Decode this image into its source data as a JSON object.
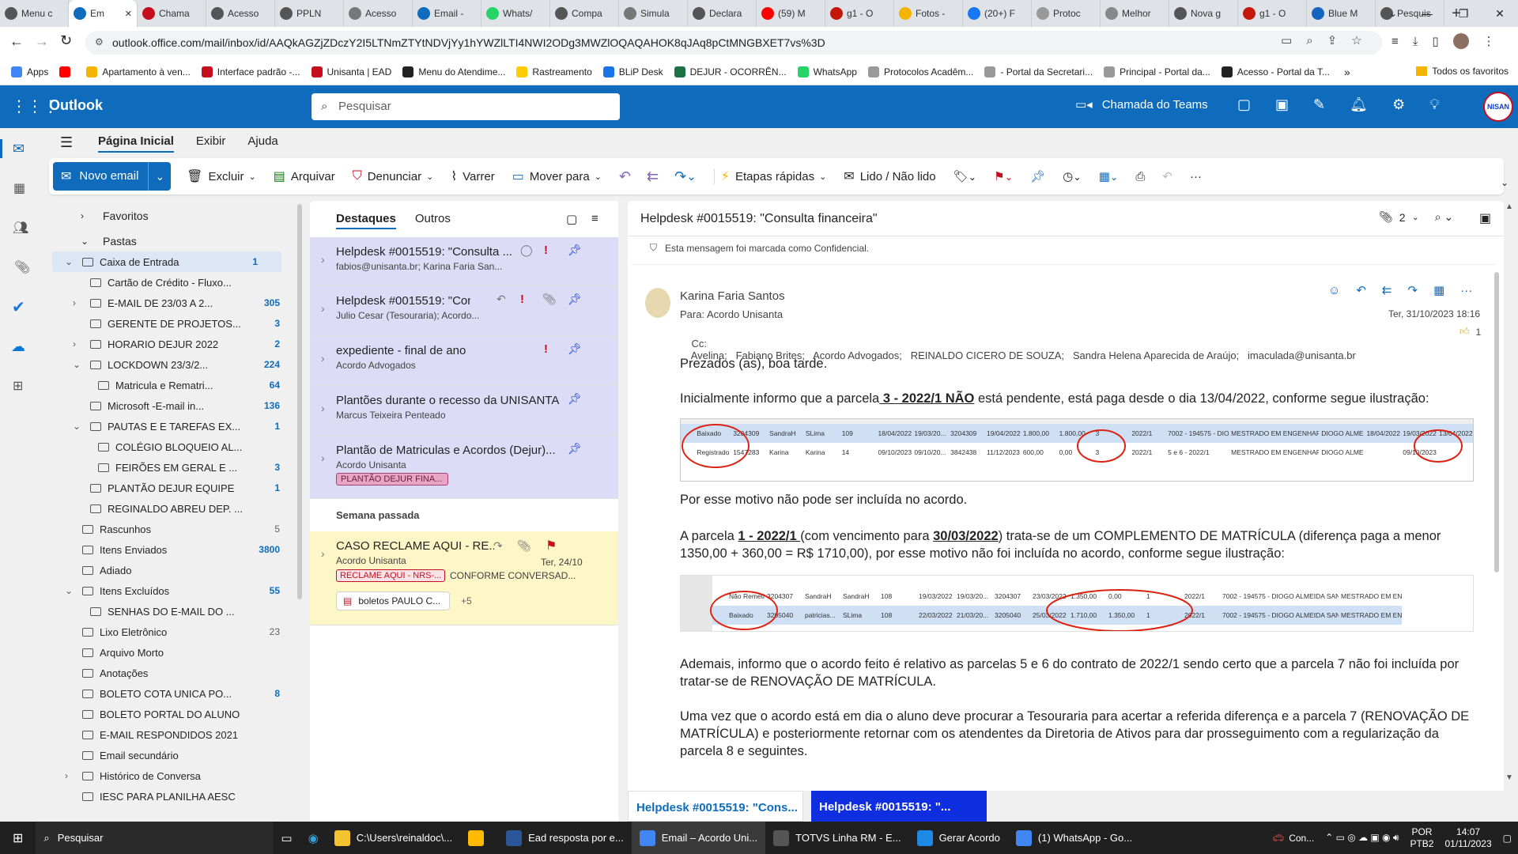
{
  "browser": {
    "tabs": [
      {
        "label": "Menu c",
        "color": "#555"
      },
      {
        "label": "Em",
        "color": "#0f6cbd",
        "active": true
      },
      {
        "label": "Chama",
        "color": "#c50f1f"
      },
      {
        "label": "Acesso",
        "color": "#555"
      },
      {
        "label": "PPLN",
        "color": "#555"
      },
      {
        "label": "Acesso",
        "color": "#777"
      },
      {
        "label": "Email -",
        "color": "#0f6cbd"
      },
      {
        "label": "Whats/",
        "color": "#25d366"
      },
      {
        "label": "Compa",
        "color": "#555"
      },
      {
        "label": "Simula",
        "color": "#777"
      },
      {
        "label": "Declara",
        "color": "#555"
      },
      {
        "label": "(59) M",
        "color": "#ff0000"
      },
      {
        "label": "g1 - O",
        "color": "#c4170c"
      },
      {
        "label": "Fotos -",
        "color": "#f4b400"
      },
      {
        "label": "(20+) F",
        "color": "#1877f2"
      },
      {
        "label": "Protoc",
        "color": "#999"
      },
      {
        "label": "Melhor",
        "color": "#888"
      },
      {
        "label": "Nova g",
        "color": "#555"
      },
      {
        "label": "g1 - O",
        "color": "#c4170c"
      },
      {
        "label": "Blue M",
        "color": "#1565c0"
      },
      {
        "label": "Pesquis",
        "color": "#555"
      }
    ],
    "url": "outlook.office.com/mail/inbox/id/AAQkAGZjZDczY2I5LTNmZTYtNDVjYy1hYWZlLTI4NWI2ODg3MWZlOQAQAHOK8qJAq8pCtMNGBXET7vs%3D",
    "bookmarks": [
      {
        "label": "Apps",
        "color": "#4285f4"
      },
      {
        "label": "",
        "color": "#ff0000"
      },
      {
        "label": "Apartamento à ven...",
        "color": "#f4b400"
      },
      {
        "label": "Interface padrão -...",
        "color": "#c50f1f"
      },
      {
        "label": "Unisanta | EAD",
        "color": "#c50f1f"
      },
      {
        "label": "Menu do Atendime...",
        "color": "#222"
      },
      {
        "label": "Rastreamento",
        "color": "#ffcc00"
      },
      {
        "label": "BLiP Desk",
        "color": "#1a73e8"
      },
      {
        "label": "DEJUR - OCORRÊN...",
        "color": "#1e7145"
      },
      {
        "label": "WhatsApp",
        "color": "#25d366"
      },
      {
        "label": "Protocolos Acadêm...",
        "color": "#999"
      },
      {
        "label": "- Portal da Secretari...",
        "color": "#999"
      },
      {
        "label": "Principal - Portal da...",
        "color": "#999"
      },
      {
        "label": "Acesso - Portal da T...",
        "color": "#222"
      }
    ],
    "bookmarks_more": "»",
    "all_favorites": "Todos os favoritos"
  },
  "outlook": {
    "app_name": "Outlook",
    "search_placeholder": "Pesquisar",
    "teams_call": "Chamada do Teams",
    "avatar_text": "NISAN",
    "ribbon_tabs": [
      "Página Inicial",
      "Exibir",
      "Ajuda"
    ],
    "ribbon": {
      "new_mail": "Novo email",
      "delete": "Excluir",
      "archive": "Arquivar",
      "report": "Denunciar",
      "sweep": "Varrer",
      "move_to": "Mover para",
      "quick_steps": "Etapas rápidas",
      "read_unread": "Lido / Não lido",
      "more": "···"
    }
  },
  "folders": {
    "favorites": "Favoritos",
    "folders": "Pastas",
    "items": [
      {
        "label": "Caixa de Entrada",
        "count": "1",
        "indent": 1,
        "chev": "v",
        "selected": true,
        "bold_count": true
      },
      {
        "label": "Cartão de Crédito - Fluxo...",
        "count": "",
        "indent": 2,
        "chev": ""
      },
      {
        "label": "E-MAIL DE 23/03 A 2...",
        "count": "305",
        "indent": 2,
        "chev": ">",
        "bold_count": true
      },
      {
        "label": "GERENTE DE PROJETOS...",
        "count": "3",
        "indent": 2,
        "chev": "",
        "bold_count": true
      },
      {
        "label": "HORARIO DEJUR 2022",
        "count": "2",
        "indent": 2,
        "chev": ">",
        "bold_count": true
      },
      {
        "label": "LOCKDOWN 23/3/2...",
        "count": "224",
        "indent": 2,
        "chev": "v",
        "bold_count": true
      },
      {
        "label": "Matricula e Rematri...",
        "count": "64",
        "indent": 3,
        "chev": "",
        "bold_count": true
      },
      {
        "label": "Microsoft -E-mail in...",
        "count": "136",
        "indent": 2,
        "chev": "",
        "bold_count": true
      },
      {
        "label": "PAUTAS E E TAREFAS EX...",
        "count": "1",
        "indent": 2,
        "chev": "v",
        "bold_count": true
      },
      {
        "label": "COLÉGIO BLOQUEIO AL...",
        "count": "",
        "indent": 3,
        "chev": ""
      },
      {
        "label": "FEIRÕES EM GERAL E ...",
        "count": "3",
        "indent": 3,
        "chev": "",
        "bold_count": true
      },
      {
        "label": "PLANTÃO DEJUR EQUIPE",
        "count": "1",
        "indent": 2,
        "chev": "",
        "bold_count": true
      },
      {
        "label": "REGINALDO ABREU DEP. ...",
        "count": "",
        "indent": 2,
        "chev": ""
      },
      {
        "label": "Rascunhos",
        "count": "5",
        "indent": 1,
        "chev": ""
      },
      {
        "label": "Itens Enviados",
        "count": "3800",
        "indent": 1,
        "chev": "",
        "bold_count": true
      },
      {
        "label": "Adiado",
        "count": "",
        "indent": 1,
        "chev": ""
      },
      {
        "label": "Itens Excluídos",
        "count": "55",
        "indent": 1,
        "chev": "v",
        "bold_count": true
      },
      {
        "label": "SENHAS DO E-MAIL DO ...",
        "count": "",
        "indent": 2,
        "chev": ""
      },
      {
        "label": "Lixo Eletrônico",
        "count": "23",
        "indent": 1,
        "chev": ""
      },
      {
        "label": "Arquivo Morto",
        "count": "",
        "indent": 1,
        "chev": ""
      },
      {
        "label": "Anotações",
        "count": "",
        "indent": 1,
        "chev": ""
      },
      {
        "label": "BOLETO COTA UNICA PO...",
        "count": "8",
        "indent": 1,
        "chev": "",
        "bold_count": true
      },
      {
        "label": "BOLETO PORTAL DO ALUNO",
        "count": "",
        "indent": 1,
        "chev": ""
      },
      {
        "label": "E-MAIL RESPONDIDOS 2021",
        "count": "",
        "indent": 1,
        "chev": ""
      },
      {
        "label": "Email secundário",
        "count": "",
        "indent": 1,
        "chev": ""
      },
      {
        "label": "Histórico de Conversa",
        "count": "",
        "indent": 1,
        "chev": ">"
      },
      {
        "label": "IESC PARA PLANILHA AESC",
        "count": "",
        "indent": 1,
        "chev": ""
      }
    ]
  },
  "list": {
    "tab_focused": "Destaques",
    "tab_other": "Outros",
    "messages": [
      {
        "from": "Helpdesk #0015519: \"Consulta ...",
        "preview": "fabios@unisanta.br; Karina Faria San..."
      },
      {
        "from": "Helpdesk #0015519: \"Cons...",
        "preview": "Julio Cesar (Tesouraria); Acordo..."
      },
      {
        "from": "expediente - final de ano",
        "preview": "Acordo Advogados"
      },
      {
        "from": "Plantões durante o recesso da UNISANTA",
        "preview": "Marcus Teixeira Penteado"
      },
      {
        "from": "Plantão de Matriculas e Acordos (Dejur)...",
        "preview": "Acordo Unisanta",
        "tag": "PLANTÃO DEJUR FINA..."
      }
    ],
    "section_last_week": "Semana passada",
    "last_week": {
      "from": "CASO RECLAME AQUI - RE...",
      "preview": "Acordo Unisanta",
      "date": "Ter, 24/10",
      "tag": "RECLAME AQUI - NRS-...",
      "tag_preview": "CONFORME CONVERSAD...",
      "attachment": "boletos PAULO C...",
      "more_attachments": "+5"
    }
  },
  "reader": {
    "subject": "Helpdesk #0015519: \"Consulta financeira\"",
    "attachment_count": "2",
    "confidential": "Esta mensagem foi marcada como Confidencial.",
    "sender": "Karina Faria Santos",
    "to_label": "Para:",
    "to": "Acordo Unisanta",
    "cc_label": "Cc:",
    "cc": "Avelina;   Fabiano Brites;   Acordo Advogados;   REINALDO CICERO DE SOUZA;   Sandra Helena Aparecida de Araújo;   imaculada@unisanta.br",
    "date": "Ter, 31/10/2023 18:16",
    "likes": "1",
    "greeting": "Prezados (as), boa tarde.",
    "p1_a": "Inicialmente informo que a parcela",
    "p1_b": " 3 - 2022/1 NÃO",
    "p1_c": " está pendente, está paga desde o dia 13/04/2022, conforme segue ilustração:",
    "p2": "Por esse motivo não pode ser incluída no acordo.",
    "p3_a": "A parcela ",
    "p3_b": "1 - 2022/1 ",
    "p3_c": " (com vencimento para ",
    "p3_d": "30/03/2022",
    "p3_e": ") trata-se de um COMPLEMENTO DE MATRÍCULA (diferença paga a menor 1350,00 + 360,00 = R$ 1710,00), por esse motivo não foi incluída no acordo, conforme segue ilustração:",
    "p4": "Ademais, informo que o acordo feito é relativo as parcelas 5 e 6 do contrato de  2022/1 sendo certo que a parcela 7 não foi incluída por tratar-se de RENOVAÇÃO DE MATRÍCULA.",
    "p5": "Uma vez que o acordo está em dia o aluno deve procurar a Tesouraria para acertar a referida diferença e a parcela 7 (RENOVAÇÃO DE MATRÍCULA) e posteriormente retornar com os atendentes da Diretoria de Ativos para dar prosseguimento com a regularização da parcela 8 e seguintes.",
    "img1_rows": [
      [
        "",
        "Baixado",
        "3204309",
        "SandraH",
        "SLima",
        "109",
        "18/04/2022",
        "19/03/20...",
        "3204309",
        "19/04/2022",
        "1.800,00",
        "1.800,00",
        "3",
        "2022/1",
        "7002 - 194575 - DIOGO ...",
        "MESTRADO EM ENGENHARIA MECÂN...",
        "DIOGO ALMEIDA ...",
        "18/04/2022",
        "19/03/2022",
        "13/04/2022"
      ],
      [
        "",
        "Registrado",
        "1547283",
        "Karina",
        "Karina",
        "14",
        "09/10/2023",
        "09/10/20...",
        "3842438",
        "11/12/2023",
        "600,00",
        "0,00",
        "3",
        "2022/1",
        "5 e 6 - 2022/1",
        "MESTRADO EM ENGENHARIA MECÂN...",
        "DIOGO ALMEIDA ...",
        "",
        "09/10/2023",
        ""
      ]
    ],
    "img2_rows": [
      [
        "",
        "Não Remeti...",
        "3204307",
        "SandraH",
        "SandraH",
        "108",
        "19/03/2022",
        "19/03/20...",
        "3204307",
        "23/03/2022",
        "1.350,00",
        "0,00",
        "1",
        "2022/1",
        "7002 - 194575 - DIOGO ALMEIDA SANTOS",
        "MESTRADO EM ENG"
      ],
      [
        "",
        "Baixado",
        "3205040",
        "patricias...",
        "SLima",
        "108",
        "22/03/2022",
        "21/03/20...",
        "3205040",
        "25/03/2022",
        "1.710,00",
        "1.350,00",
        "1",
        "2022/1",
        "7002 - 194575 - DIOGO ALMEIDA SANTOS",
        "MESTRADO EM ENG"
      ],
      [
        "",
        "Cancelado",
        "3223050",
        "patricias...",
        "patriciasil...",
        "109",
        "24/03/2022",
        "24/03/20...",
        "3223050",
        "30/03/2022",
        "360,00",
        "0,00",
        "1",
        "2022/1",
        "7002 - 194575 - DIOGO ALMEIDA SANTOS",
        "MESTRADO EM ENG"
      ]
    ]
  },
  "bottom_tabs": [
    "Helpdesk #0015519: \"Cons...",
    "Helpdesk #0015519: \"..."
  ],
  "taskbar": {
    "search": "Pesquisar",
    "apps": [
      {
        "label": "C:\\Users\\reinaldoc\\...",
        "color": "#f4c430"
      },
      {
        "label": "",
        "color": "#ffb900"
      },
      {
        "label": "Ead resposta por e...",
        "color": "#2b579a"
      },
      {
        "label": "Email – Acordo Uni...",
        "color": "#4285f4"
      },
      {
        "label": "TOTVS Linha RM - E...",
        "color": "#555"
      },
      {
        "label": "Gerar Acordo",
        "color": "#1e88e5"
      },
      {
        "label": "(1) WhatsApp - Go...",
        "color": "#4285f4"
      }
    ],
    "weather": "Con...",
    "lang": "POR",
    "layout": "PTB2",
    "time": "14:07",
    "date": "01/11/2023"
  }
}
